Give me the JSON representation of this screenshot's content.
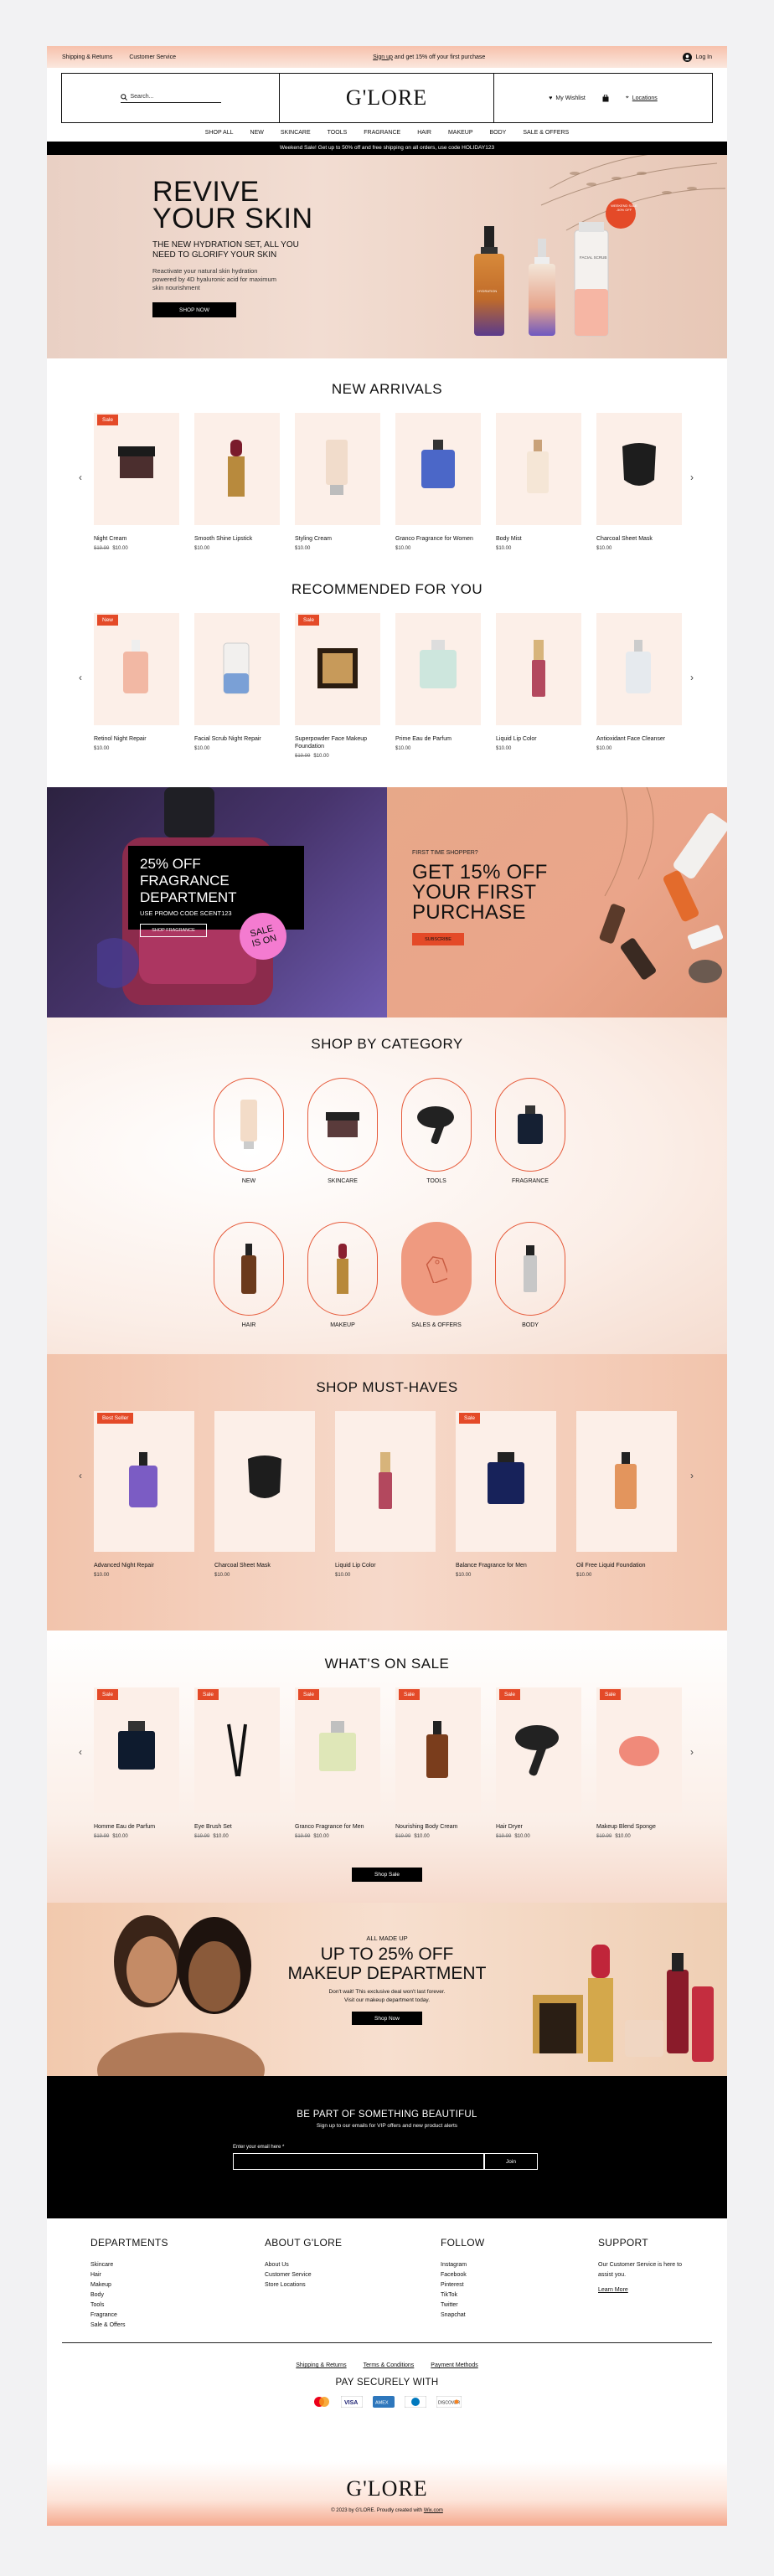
{
  "topbar": {
    "shipping": "Shipping & Returns",
    "customer_service": "Customer Service",
    "promo_link": "Sign up",
    "promo_rest": "and get 15% off your first purchase",
    "login": "Log In"
  },
  "header": {
    "search_placeholder": "Search...",
    "logo": "G'LORE",
    "wishlist": "My Wishlist",
    "locations": "Locations"
  },
  "nav": [
    "SHOP ALL",
    "NEW",
    "SKINCARE",
    "TOOLS",
    "FRAGRANCE",
    "HAIR",
    "MAKEUP",
    "BODY",
    "SALE & OFFERS"
  ],
  "promo_bar": "Weekend Sale! Get up to 50% off and free shipping on all orders, use code HOLIDAY123",
  "hero": {
    "title_line1": "REVIVE",
    "title_line2": "YOUR SKIN",
    "subtitle": "THE NEW HYDRATION SET, ALL YOU NEED TO GLORIFY YOUR SKIN",
    "desc": "Reactivate your natural skin hydration powered by 4D hyaluronic acid for maximum skin nourishment",
    "button": "SHOP NOW",
    "badge": "WEEKEND SALE -50% OFF",
    "bottle1": "HYDRATION",
    "bottle3": "FACIAL SCRUB"
  },
  "new_arrivals": {
    "title": "NEW ARRIVALS",
    "items": [
      {
        "name": "Night Cream",
        "old": "$19.99",
        "price": "$10.00",
        "badge": "Sale"
      },
      {
        "name": "Smooth Shine Lipstick",
        "old": "",
        "price": "$10.00",
        "badge": ""
      },
      {
        "name": "Styling Cream",
        "old": "",
        "price": "$10.00",
        "badge": ""
      },
      {
        "name": "Granco Fragrance for Women",
        "old": "",
        "price": "$10.00",
        "badge": ""
      },
      {
        "name": "Body Mist",
        "old": "",
        "price": "$10.00",
        "badge": ""
      },
      {
        "name": "Charcoal Sheet Mask",
        "old": "",
        "price": "$10.00",
        "badge": ""
      }
    ]
  },
  "recommended": {
    "title": "RECOMMENDED FOR YOU",
    "items": [
      {
        "name": "Retinol Night Repair",
        "old": "",
        "price": "$10.00",
        "badge": "New"
      },
      {
        "name": "Facial Scrub Night Repair",
        "old": "",
        "price": "$10.00",
        "badge": ""
      },
      {
        "name": "Superpowder Face Makeup Foundation",
        "old": "$19.99",
        "price": "$10.00",
        "badge": "Sale"
      },
      {
        "name": "Prime Eau de Parfum",
        "old": "",
        "price": "$10.00",
        "badge": ""
      },
      {
        "name": "Liquid Lip Color",
        "old": "",
        "price": "$10.00",
        "badge": ""
      },
      {
        "name": "Antioxidant Face Cleanser",
        "old": "",
        "price": "$10.00",
        "badge": ""
      }
    ]
  },
  "fragrance_banner": {
    "title_line1": "25% OFF FRAGRANCE",
    "title_line2": "DEPARTMENT",
    "code": "USE PROMO CODE SCENT123",
    "button": "SHOP FRAGRANCE",
    "sticker_line1": "SALE",
    "sticker_line2": "IS ON"
  },
  "first_banner": {
    "eyebrow": "FIRST TIME SHOPPER?",
    "title_line1": "GET 15% OFF",
    "title_line2": "YOUR FIRST",
    "title_line3": "PURCHASE",
    "button": "SUBSCRIBE"
  },
  "categories": {
    "title": "SHOP BY CATEGORY",
    "items": [
      "NEW",
      "SKINCARE",
      "TOOLS",
      "FRAGRANCE",
      "HAIR",
      "MAKEUP",
      "SALES & OFFERS",
      "BODY"
    ]
  },
  "must_haves": {
    "title": "SHOP MUST-HAVES",
    "items": [
      {
        "name": "Advanced Night Repair",
        "price": "$10.00",
        "badge": "Best Seller"
      },
      {
        "name": "Charcoal Sheet Mask",
        "price": "$10.00",
        "badge": ""
      },
      {
        "name": "Liquid Lip Color",
        "price": "$10.00",
        "badge": ""
      },
      {
        "name": "Balance Fragrance for Men",
        "price": "$10.00",
        "badge": "Sale"
      },
      {
        "name": "Oil Free Liquid Foundation",
        "price": "$10.00",
        "badge": ""
      }
    ]
  },
  "on_sale": {
    "title": "WHAT'S ON SALE",
    "button": "Shop Sale",
    "items": [
      {
        "name": "Homme Eau de Parfum",
        "old": "$19.99",
        "price": "$10.00",
        "badge": "Sale"
      },
      {
        "name": "Eye Brush Set",
        "old": "$19.99",
        "price": "$10.00",
        "badge": "Sale"
      },
      {
        "name": "Granco Fragrance for Men",
        "old": "$19.99",
        "price": "$10.00",
        "badge": "Sale"
      },
      {
        "name": "Nourishing Body Cream",
        "old": "$19.99",
        "price": "$10.00",
        "badge": "Sale"
      },
      {
        "name": "Hair Dryer",
        "old": "$19.99",
        "price": "$10.00",
        "badge": "Sale"
      },
      {
        "name": "Makeup Blend Sponge",
        "old": "$19.99",
        "price": "$10.00",
        "badge": "Sale"
      }
    ]
  },
  "makeup_banner": {
    "eyebrow": "ALL MADE UP",
    "title_line1": "UP TO 25% OFF",
    "title_line2": "MAKEUP DEPARTMENT",
    "desc_line1": "Don't wait! This exclusive deal won't last forever.",
    "desc_line2": "Visit our makeup department today.",
    "button": "Shop Now"
  },
  "newsletter": {
    "title": "BE PART OF SOMETHING BEAUTIFUL",
    "sub": "Sign up to our emails for VIP offers and new product alerts",
    "label": "Enter your email here *",
    "button": "Join"
  },
  "footer": {
    "departments": {
      "title": "DEPARTMENTS",
      "items": [
        "Skincare",
        "Hair",
        "Makeup",
        "Body",
        "Tools",
        "Fragrance",
        "Sale & Offers"
      ]
    },
    "about": {
      "title": "ABOUT G'LORE",
      "items": [
        "About Us",
        "Customer Service",
        "Store Locations"
      ]
    },
    "follow": {
      "title": "FOLLOW",
      "items": [
        "Instagram",
        "Facebook",
        "Pinterest",
        "TikTok",
        "Twitter",
        "Snapchat"
      ]
    },
    "support": {
      "title": "SUPPORT",
      "text": "Our Customer Service is here to assist you.",
      "link": "Learn More"
    },
    "links": [
      "Shipping & Returns",
      "Terms & Conditions",
      "Payment Methods"
    ],
    "pay_title": "PAY SECURELY WITH",
    "payments": [
      "mastercard",
      "VISA",
      "AMEX",
      "DINERS",
      "DISCOVER"
    ],
    "logo": "G'LORE",
    "copyright": "© 2023 by G'LORE. Proudly created with",
    "copyright_link": "Wix.com"
  },
  "colors": {
    "accent": "#e44a28",
    "black": "#000000",
    "peach": "#f7c1ab"
  }
}
